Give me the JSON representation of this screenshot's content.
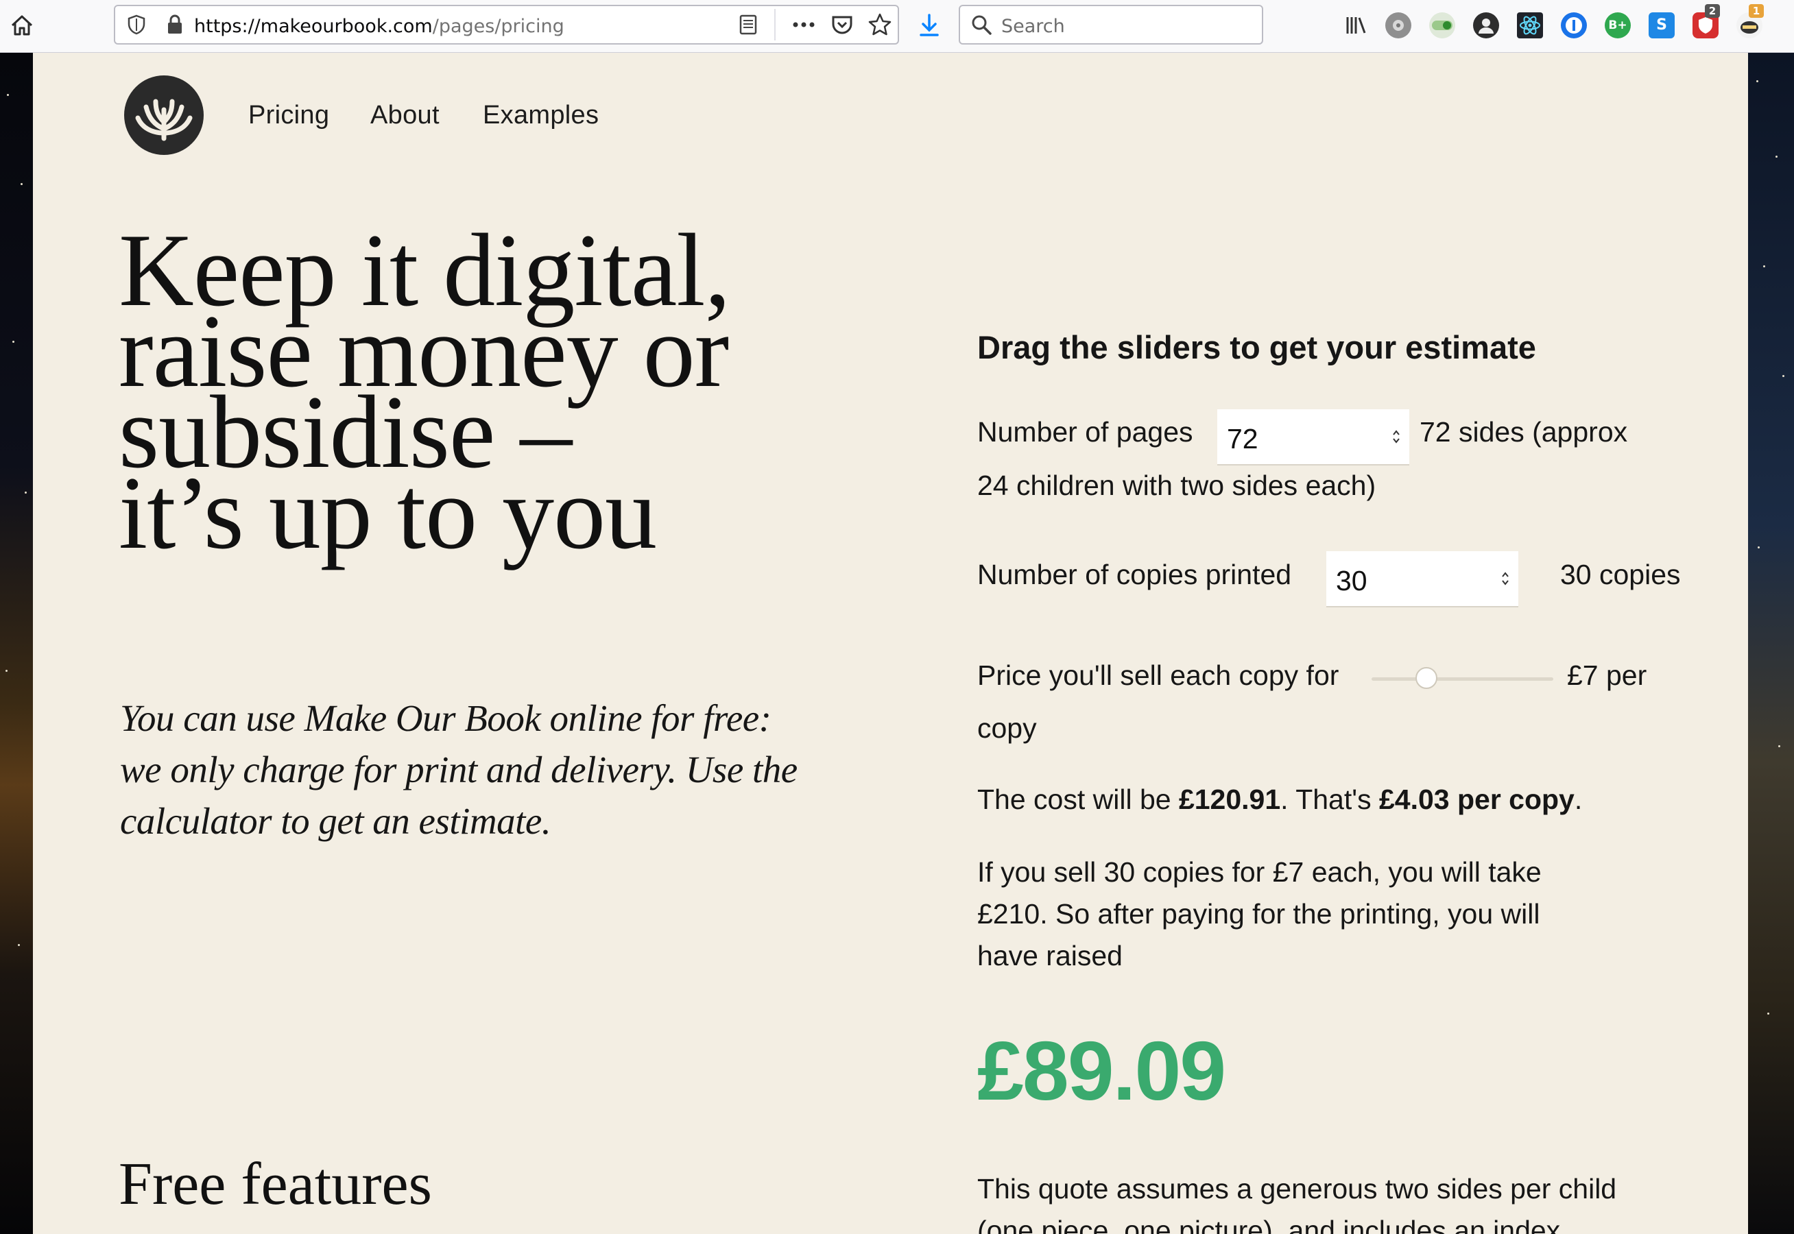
{
  "browser": {
    "url_host": "https://makeourbook.com",
    "url_path": "/pages/pricing",
    "search_placeholder": "Search",
    "badges": {
      "ext_red_count": "2",
      "ext_last_count": "1"
    }
  },
  "nav": {
    "items": [
      "Pricing",
      "About",
      "Examples"
    ]
  },
  "hero": {
    "headline_lines": [
      "Keep it digital,",
      "raise money or",
      "subsidise –",
      "it’s up to you"
    ],
    "intro": "You can use Make Our Book online for free: we only charge for print and delivery. Use the calculator to get an estimate."
  },
  "features": {
    "heading": "Free features"
  },
  "calculator": {
    "heading": "Drag the sliders to get your estimate",
    "pages_label": "Number of pages",
    "pages_value": "72",
    "pages_note_1": "72 sides (approx",
    "pages_note_2": "24 children with two sides each)",
    "copies_label": "Number of copies printed",
    "copies_value": "30",
    "copies_note": "30 copies",
    "price_label": "Price you'll sell each copy for",
    "price_note_1": "£7 per",
    "price_note_2": "copy",
    "price_slider_level": 0.3,
    "cost_prefix": "The cost will be ",
    "cost_total": "£120.91",
    "cost_mid": ". That's ",
    "cost_per_copy": "£4.03 per copy",
    "cost_suffix": ".",
    "sell_line_1": "If you sell 30 copies for £7 each, you will take",
    "sell_line_2": "£210. So after paying for the printing, you will",
    "sell_line_3": "have raised",
    "raised_amount": "£89.09",
    "footnote_1": "This quote assumes a generous two sides per child",
    "footnote_2": "(one piece, one picture), and includes an index"
  },
  "colors": {
    "page_bg": "#f3eee3",
    "accent_green": "#3aaa6e",
    "text": "#161616",
    "download_blue": "#0a84ff"
  }
}
